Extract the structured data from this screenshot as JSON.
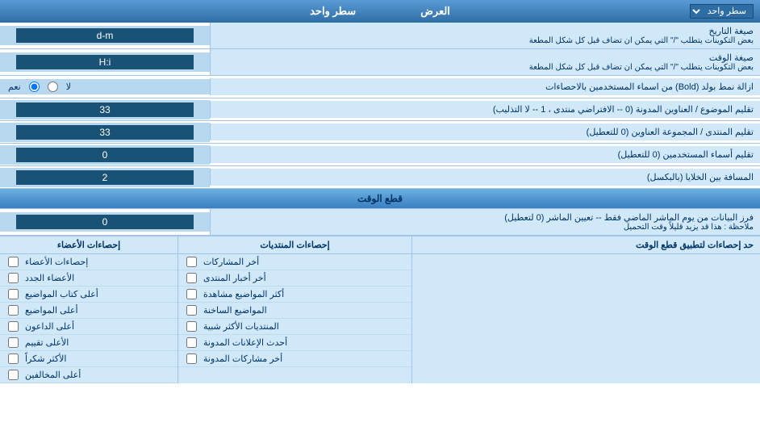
{
  "header": {
    "title": "سطر واحد",
    "dropdown_value": "سطر واحد",
    "field_label": "العرض"
  },
  "date_format": {
    "label": "صيغة التاريخ",
    "sublabel": "بعض التكوينات يتطلب \"/\" التي يمكن ان تضاف قبل كل شكل المطعة",
    "value": "d-m"
  },
  "time_format": {
    "label": "صيغة الوقت",
    "sublabel": "بعض التكوينات يتطلب \"/\" التي يمكن ان تضاف قبل كل شكل المطعة",
    "value": "H:i"
  },
  "bold_remove": {
    "label": "ازالة نمط بولد (Bold) من اسماء المستخدمين بالاحصاءات",
    "option_yes": "نعم",
    "option_no": "لا",
    "selected": "no"
  },
  "topic_titles": {
    "label": "تقليم الموضوع / العناوين المدونة (0 -- الافتراضي منتدى ، 1 -- لا التذليب)",
    "value": "33"
  },
  "forum_group": {
    "label": "تقليم المنتدى / المجموعة العناوين (0 للتعطيل)",
    "value": "33"
  },
  "usernames": {
    "label": "تقليم أسماء المستخدمين (0 للتعطيل)",
    "value": "0"
  },
  "cell_spacing": {
    "label": "المسافة بين الخلايا (بالبكسل)",
    "value": "2"
  },
  "time_cut_section": {
    "title": "قطع الوقت"
  },
  "time_filter": {
    "label": "فرز البيانات من يوم الماشر الماضي فقط -- تعيين الماشر (0 لتعطيل)",
    "note": "ملاحظة : هذا قد يزيد قليلاً وقت التحميل",
    "value": "0"
  },
  "stats_limit": {
    "label": "حد إحصاءات لتطبيق قطع الوقت"
  },
  "stats_posts_header": "إحصاءات المنتديات",
  "stats_members_header": "إحصاءات الأعضاء",
  "stats_posts_items": [
    "أخر المشاركات",
    "أخر أخبار المنتدى",
    "أكثر المواضيع مشاهدة",
    "المواضيع الساخنة",
    "المنتديات الأكثر شبية",
    "أحدث الإعلانات المدونة",
    "أخر مشاركات المدونة"
  ],
  "stats_members_items": [
    "إحصاءات الأعضاء",
    "الأعضاء الجدد",
    "أعلى كتاب المواضيع",
    "أعلى المواضيع",
    "أعلى الداعون",
    "الأعلى تقييم",
    "الأكثر شكراً",
    "أعلى المخالفين"
  ]
}
